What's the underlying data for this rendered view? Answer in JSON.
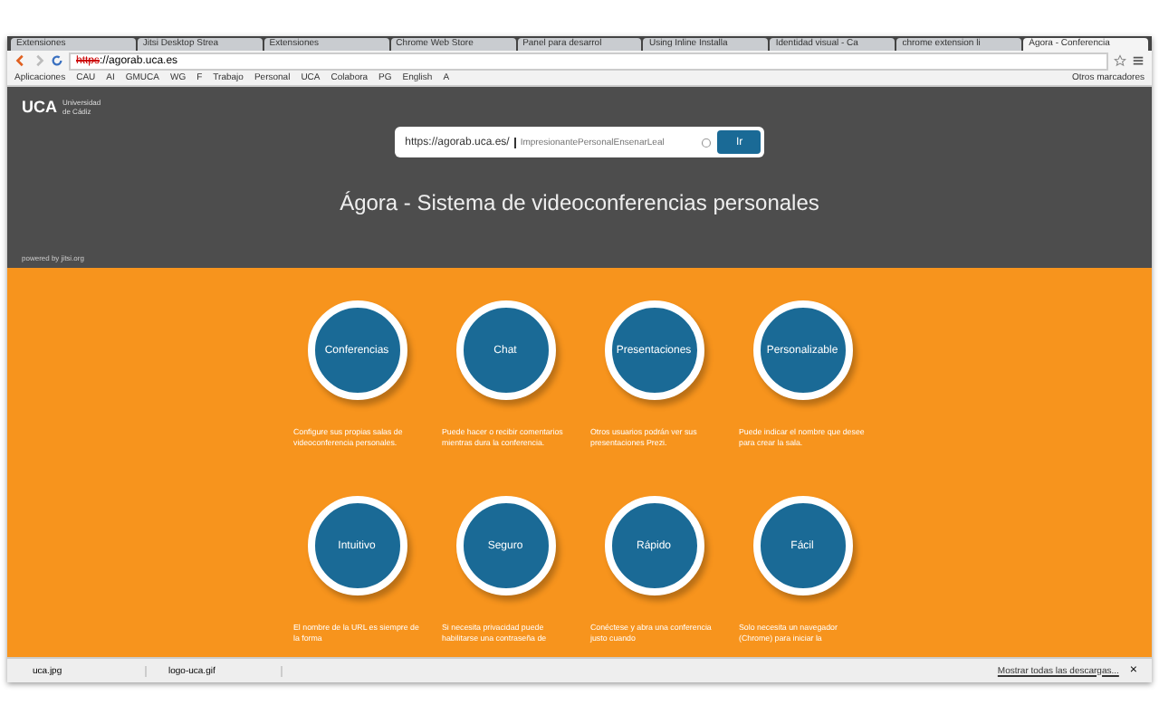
{
  "tabs": [
    {
      "label": "Extensiones",
      "selected": false
    },
    {
      "label": "Jitsi Desktop Strea",
      "selected": false
    },
    {
      "label": "Extensiones",
      "selected": false
    },
    {
      "label": "Chrome Web Store",
      "selected": false
    },
    {
      "label": "Panel para desarrol",
      "selected": false
    },
    {
      "label": "Using Inline Installa",
      "selected": false
    },
    {
      "label": "Identidad visual - Ca",
      "selected": false
    },
    {
      "label": "chrome extension li",
      "selected": false
    },
    {
      "label": "Ágora - Conferencia",
      "selected": true
    }
  ],
  "address": {
    "scheme": "https",
    "rest": "://agorab.uca.es"
  },
  "bookmarks": [
    "Aplicaciones",
    "CAU",
    "AI",
    "GMUCA",
    "WG",
    "F",
    "Trabajo",
    "Personal",
    "UCA",
    "Colabora",
    "PG",
    "English",
    "A"
  ],
  "other_bookmarks": "Otros marcadores",
  "header": {
    "logo": "UCA",
    "university": "Universidad de Cádiz",
    "url_prefix": "https://agorab.uca.es/",
    "placeholder": "ImpresionantePersonalEnsenarLeal",
    "go": "Ir",
    "title": "Ágora - Sistema de videoconferencias personales",
    "powered": "powered by jitsi.org"
  },
  "features": [
    {
      "title": "Conferencias",
      "description": "Configure sus propias salas de videoconferencia personales."
    },
    {
      "title": "Chat",
      "description": "Puede hacer o recibir comentarios mientras dura la conferencia."
    },
    {
      "title": "Presentaciones",
      "description": "Otros usuarios podrán ver sus presentaciones Prezi."
    },
    {
      "title": "Personalizable",
      "description": "Puede indicar el nombre que desee para crear la sala."
    },
    {
      "title": "Intuitivo",
      "description": "El nombre de la URL es siempre de la forma"
    },
    {
      "title": "Seguro",
      "description": "Si necesita privacidad puede habilitarse una contraseña de"
    },
    {
      "title": "Rápido",
      "description": "Conéctese y abra una conferencia justo cuando"
    },
    {
      "title": "Fácil",
      "description": "Solo necesita un navegador (Chrome) para iniciar la"
    }
  ],
  "downloads": [
    "uca.jpg",
    "logo-uca.gif"
  ],
  "show_all": "Mostrar todas las descargas...",
  "close": "×"
}
